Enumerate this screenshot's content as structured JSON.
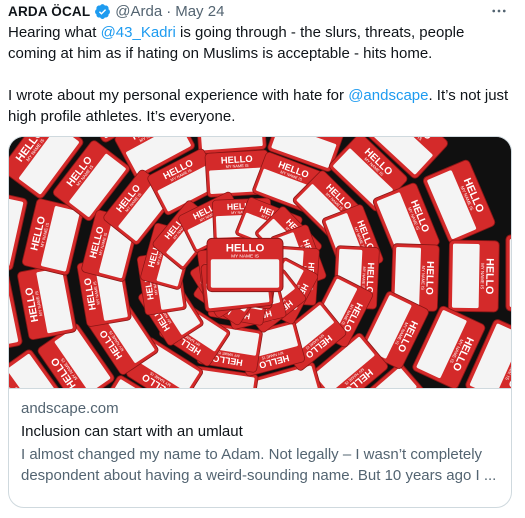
{
  "tweet": {
    "author_name": "ARDA ÖCAL",
    "handle": "@Arda",
    "separator": "·",
    "date": "May 24",
    "more_icon": "more-dots-icon",
    "text_part1": "Hearing what ",
    "mention1": "@43_Kadri",
    "text_part2": " is going through - the slurs, threats, people coming at him as if hating on Muslims is acceptable - hits home.",
    "text_part3": "I wrote about my personal experience with hate for ",
    "mention2": "@andscape",
    "text_part4": ". It’s not just high profile athletes. It’s everyone."
  },
  "card": {
    "image_tag_line1": "HELLO",
    "image_tag_line2": "MY NAME IS",
    "domain": "andscape.com",
    "title": "Inclusion can start with an umlaut",
    "description": "I almost changed my name to Adam. Not legally – I wasn’t completely despondent about having a weird-sounding name. But 10 years ago I ..."
  },
  "colors": {
    "accent": "#1d9bf0",
    "tag_red": "#d42a2a",
    "image_bg": "#101010"
  }
}
